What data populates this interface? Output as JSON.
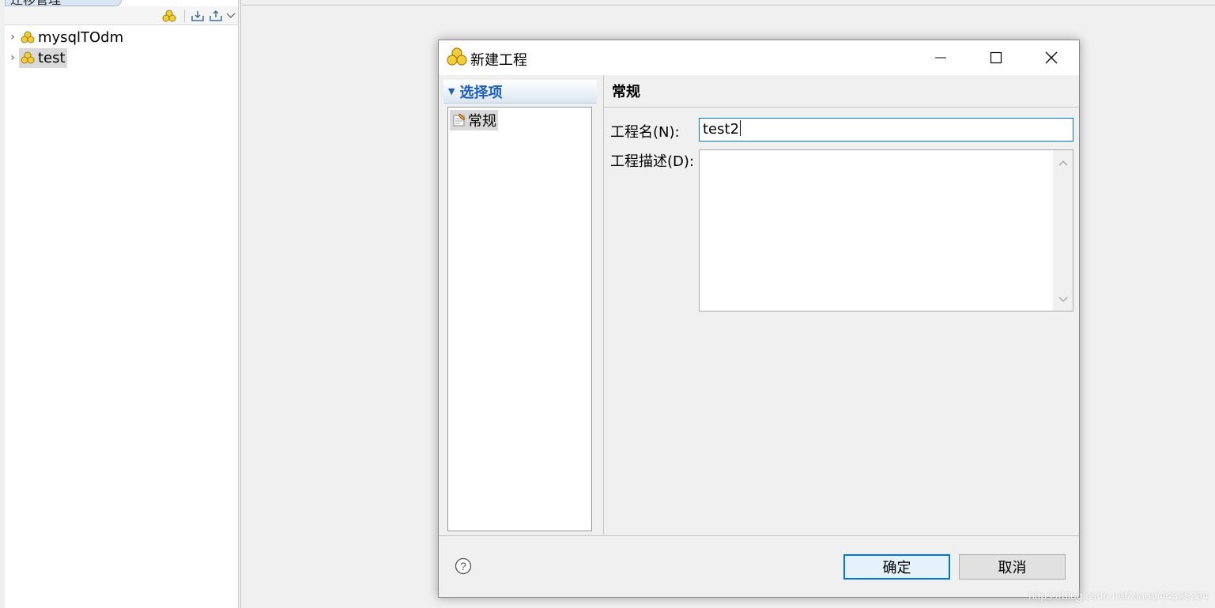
{
  "explorer": {
    "view_title": "迁移管理",
    "items": [
      {
        "label": "mysqlTOdm",
        "selected": false
      },
      {
        "label": "test",
        "selected": true
      }
    ]
  },
  "dialog": {
    "title": "新建工程",
    "nav": {
      "header": "选择项",
      "items": [
        {
          "label": "常规"
        }
      ]
    },
    "content": {
      "header": "常规",
      "name_label": "工程名(N):",
      "name_value": "test2",
      "desc_label": "工程描述(D):",
      "desc_value": ""
    },
    "buttons": {
      "ok": "确定",
      "cancel": "取消"
    }
  },
  "watermark": "https://blog.csdn.net/xiaoqi44325234",
  "colors": {
    "accent": "#0078d7",
    "nav_header_text": "#1a5fb4",
    "icon_gold": "#e8b923"
  },
  "icons": [
    "project-icon",
    "expand-arrow-icon",
    "new-project-icon",
    "import-icon",
    "export-icon",
    "view-menu-icon",
    "minimize-icon",
    "maximize-icon",
    "close-icon",
    "page-icon",
    "help-icon",
    "scroll-up-icon",
    "scroll-down-icon"
  ]
}
